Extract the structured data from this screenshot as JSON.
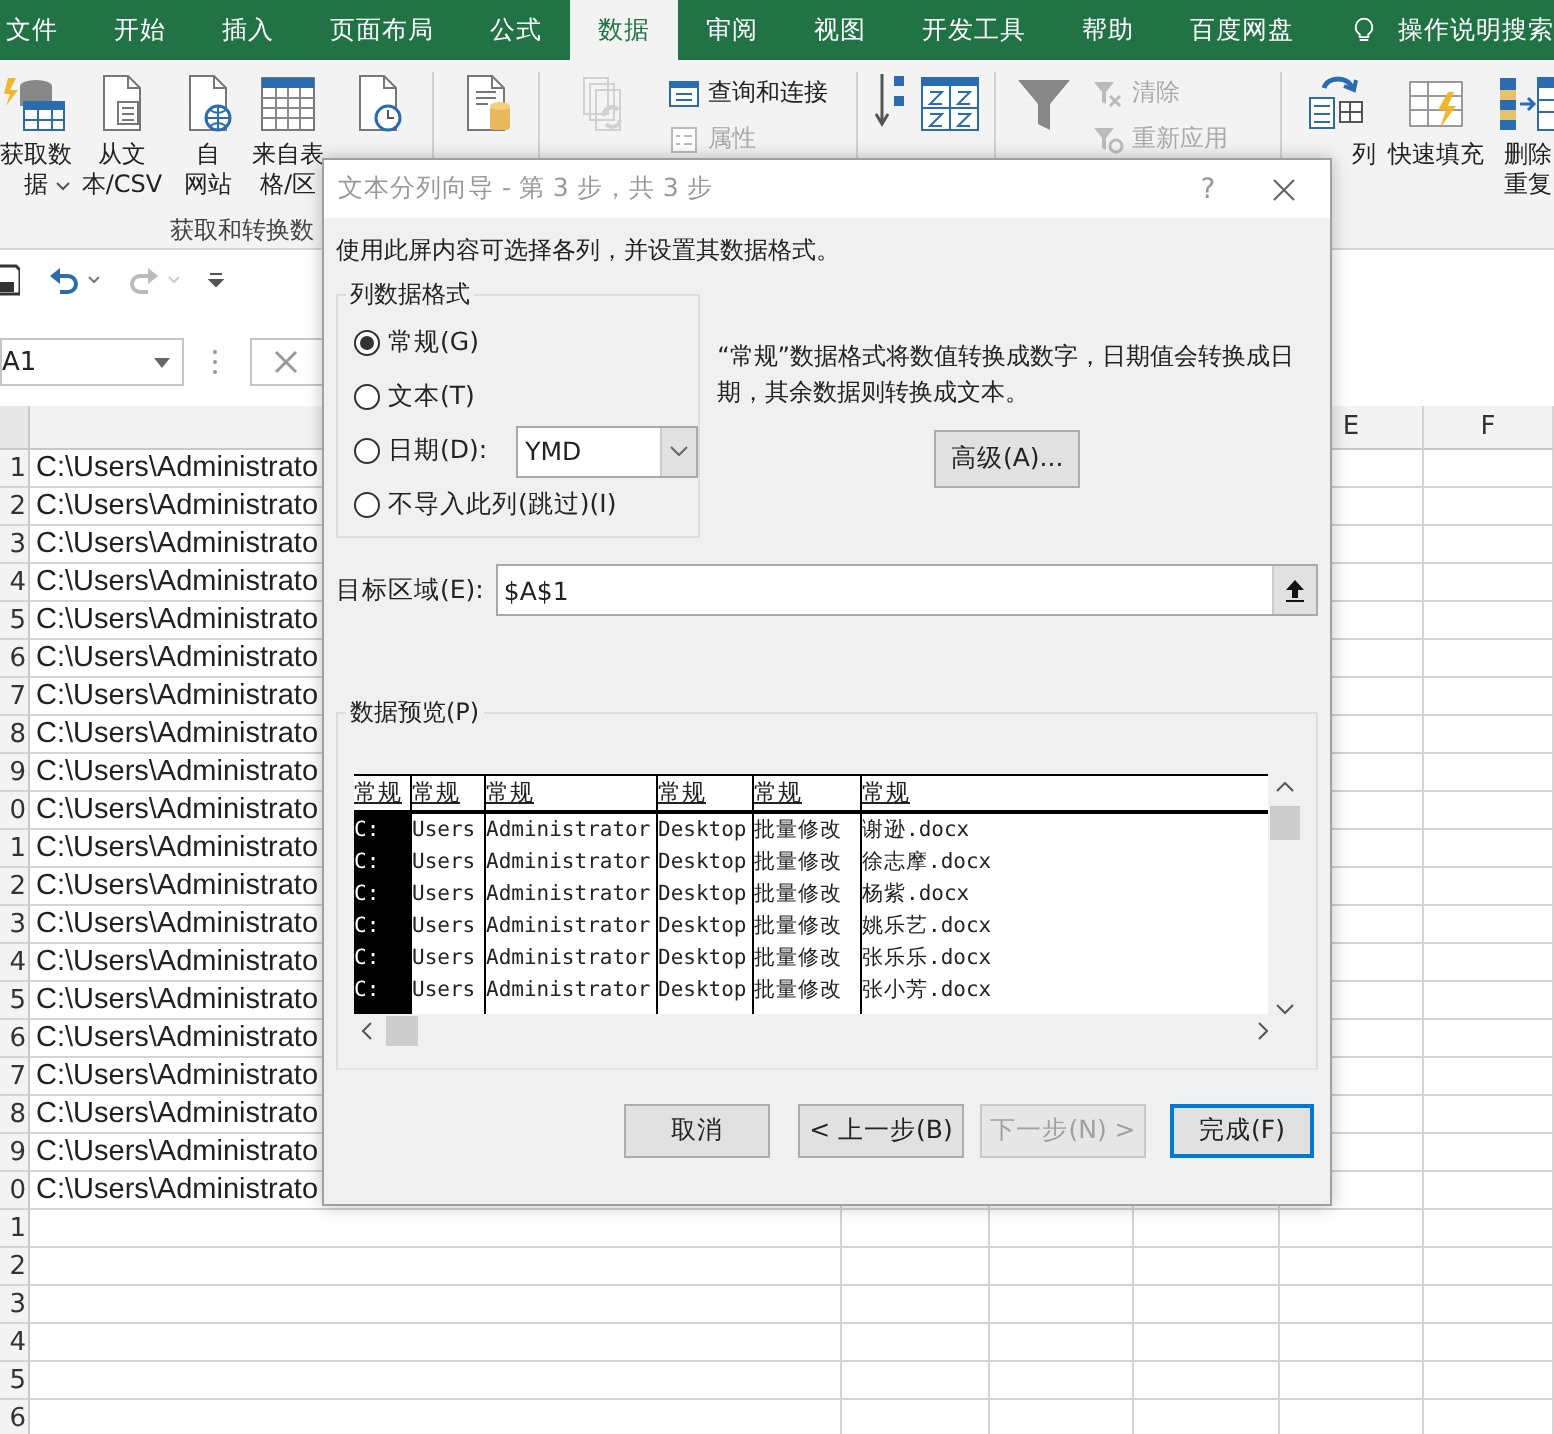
{
  "menu_tabs": [
    {
      "label": "文件",
      "selected": false
    },
    {
      "label": "开始",
      "selected": false
    },
    {
      "label": "插入",
      "selected": false
    },
    {
      "label": "页面布局",
      "selected": false
    },
    {
      "label": "公式",
      "selected": false
    },
    {
      "label": "数据",
      "selected": true
    },
    {
      "label": "审阅",
      "selected": false
    },
    {
      "label": "视图",
      "selected": false
    },
    {
      "label": "开发工具",
      "selected": false
    },
    {
      "label": "帮助",
      "selected": false
    },
    {
      "label": "百度网盘",
      "selected": false
    }
  ],
  "tell_me": "操作说明搜索",
  "ribbon": {
    "items": [
      {
        "kind": "large",
        "lines": [
          "获取数",
          "据"
        ],
        "dropdown": true,
        "disabled": false
      },
      {
        "kind": "large",
        "lines": [
          "从文",
          "本/CSV"
        ],
        "disabled": false
      },
      {
        "kind": "large",
        "lines": [
          "自",
          "网站"
        ],
        "disabled": false
      },
      {
        "kind": "large",
        "lines": [
          "来自表",
          "格/区"
        ],
        "disabled": false
      },
      {
        "kind": "large",
        "disabled": false
      },
      {
        "kind": "separator"
      },
      {
        "kind": "large",
        "disabled": false
      },
      {
        "kind": "separator"
      },
      {
        "kind": "large",
        "disabled": true
      },
      {
        "kind": "stack",
        "entries": [
          {
            "label": "查询和连接",
            "disabled": false
          },
          {
            "label": "属性",
            "disabled": true
          }
        ]
      },
      {
        "kind": "separator"
      },
      {
        "kind": "small",
        "disabled": false
      },
      {
        "kind": "large",
        "disabled": false
      },
      {
        "kind": "separator"
      },
      {
        "kind": "large",
        "disabled": false
      },
      {
        "kind": "stack",
        "entries": [
          {
            "label": "清除",
            "disabled": true
          },
          {
            "label": "重新应用",
            "disabled": true
          }
        ]
      },
      {
        "kind": "separator"
      },
      {
        "kind": "large",
        "lines": [
          "列"
        ],
        "disabled": false
      },
      {
        "kind": "large",
        "lines": [
          "快速填充"
        ],
        "disabled": false
      },
      {
        "kind": "large",
        "lines": [
          "删除",
          "重复"
        ],
        "disabled": false
      }
    ],
    "group_label": "获取和转换数"
  },
  "quick_access": {
    "undo_disabled": false,
    "redo_disabled": true
  },
  "name_box": {
    "value": "A1"
  },
  "sheet": {
    "column_headers": [
      "E",
      "F"
    ],
    "rows": [
      {
        "number": "1",
        "cell_a": "C:\\Users\\Administrato"
      },
      {
        "number": "2",
        "cell_a": "C:\\Users\\Administrato"
      },
      {
        "number": "3",
        "cell_a": "C:\\Users\\Administrato"
      },
      {
        "number": "4",
        "cell_a": "C:\\Users\\Administrato"
      },
      {
        "number": "5",
        "cell_a": "C:\\Users\\Administrato"
      },
      {
        "number": "6",
        "cell_a": "C:\\Users\\Administrato"
      },
      {
        "number": "7",
        "cell_a": "C:\\Users\\Administrato"
      },
      {
        "number": "8",
        "cell_a": "C:\\Users\\Administrato"
      },
      {
        "number": "9",
        "cell_a": "C:\\Users\\Administrato"
      },
      {
        "number": "0",
        "cell_a": "C:\\Users\\Administrato"
      },
      {
        "number": "1",
        "cell_a": "C:\\Users\\Administrato"
      },
      {
        "number": "2",
        "cell_a": "C:\\Users\\Administrato"
      },
      {
        "number": "3",
        "cell_a": "C:\\Users\\Administrato"
      },
      {
        "number": "4",
        "cell_a": "C:\\Users\\Administrato"
      },
      {
        "number": "5",
        "cell_a": "C:\\Users\\Administrato"
      },
      {
        "number": "6",
        "cell_a": "C:\\Users\\Administrato"
      },
      {
        "number": "7",
        "cell_a": "C:\\Users\\Administrato"
      },
      {
        "number": "8",
        "cell_a": "C:\\Users\\Administrato"
      },
      {
        "number": "9",
        "cell_a": "C:\\Users\\Administrato"
      },
      {
        "number": "0",
        "cell_a": "C:\\Users\\Administrato"
      },
      {
        "number": "1"
      },
      {
        "number": "2"
      },
      {
        "number": "3"
      },
      {
        "number": "4"
      },
      {
        "number": "5"
      },
      {
        "number": "6"
      }
    ]
  },
  "dialog": {
    "title": "文本分列向导 - 第 3 步，共 3 步",
    "help": "?",
    "intro": "使用此屏内容可选择各列，并设置其数据格式。",
    "format_group": {
      "title": "列数据格式",
      "options": [
        {
          "kind": "plain",
          "label": "常规(G)",
          "selected": true
        },
        {
          "kind": "plain",
          "label": "文本(T)",
          "selected": false
        },
        {
          "kind": "date",
          "label": "日期(D):",
          "selected": false
        },
        {
          "kind": "plain",
          "label": "不导入此列(跳过)(I)",
          "selected": false
        }
      ],
      "date_format": "YMD"
    },
    "description": "“常规”数据格式将数值转换成数字，日期值会转换成日期，其余数据则转换成文本。",
    "advanced_button": "高级(A)...",
    "destination": {
      "label": "目标区域(E):",
      "value": "$A$1"
    },
    "preview": {
      "title": "数据预览(P)",
      "columns": [
        {
          "header": "常规",
          "selected": true
        },
        {
          "header": "常规",
          "selected": false
        },
        {
          "header": "常规",
          "selected": false
        },
        {
          "header": "常规",
          "selected": false
        },
        {
          "header": "常规",
          "selected": false
        },
        {
          "header": "常规",
          "selected": false
        }
      ],
      "rows": [
        [
          "C:",
          "Users",
          "Administrator",
          "Desktop",
          "批量修改",
          "谢逊.docx"
        ],
        [
          "C:",
          "Users",
          "Administrator",
          "Desktop",
          "批量修改",
          "徐志摩.docx"
        ],
        [
          "C:",
          "Users",
          "Administrator",
          "Desktop",
          "批量修改",
          "杨紫.docx"
        ],
        [
          "C:",
          "Users",
          "Administrator",
          "Desktop",
          "批量修改",
          "姚乐艺.docx"
        ],
        [
          "C:",
          "Users",
          "Administrator",
          "Desktop",
          "批量修改",
          "张乐乐.docx"
        ],
        [
          "C:",
          "Users",
          "Administrator",
          "Desktop",
          "批量修改",
          "张小芳.docx"
        ]
      ]
    },
    "buttons": [
      {
        "label": "取消",
        "disabled": false,
        "default": false
      },
      {
        "label": "< 上一步(B)",
        "disabled": false,
        "default": false
      },
      {
        "label": "下一步(N) >",
        "disabled": true,
        "default": false
      },
      {
        "label": "完成(F)",
        "disabled": false,
        "default": true
      }
    ]
  }
}
